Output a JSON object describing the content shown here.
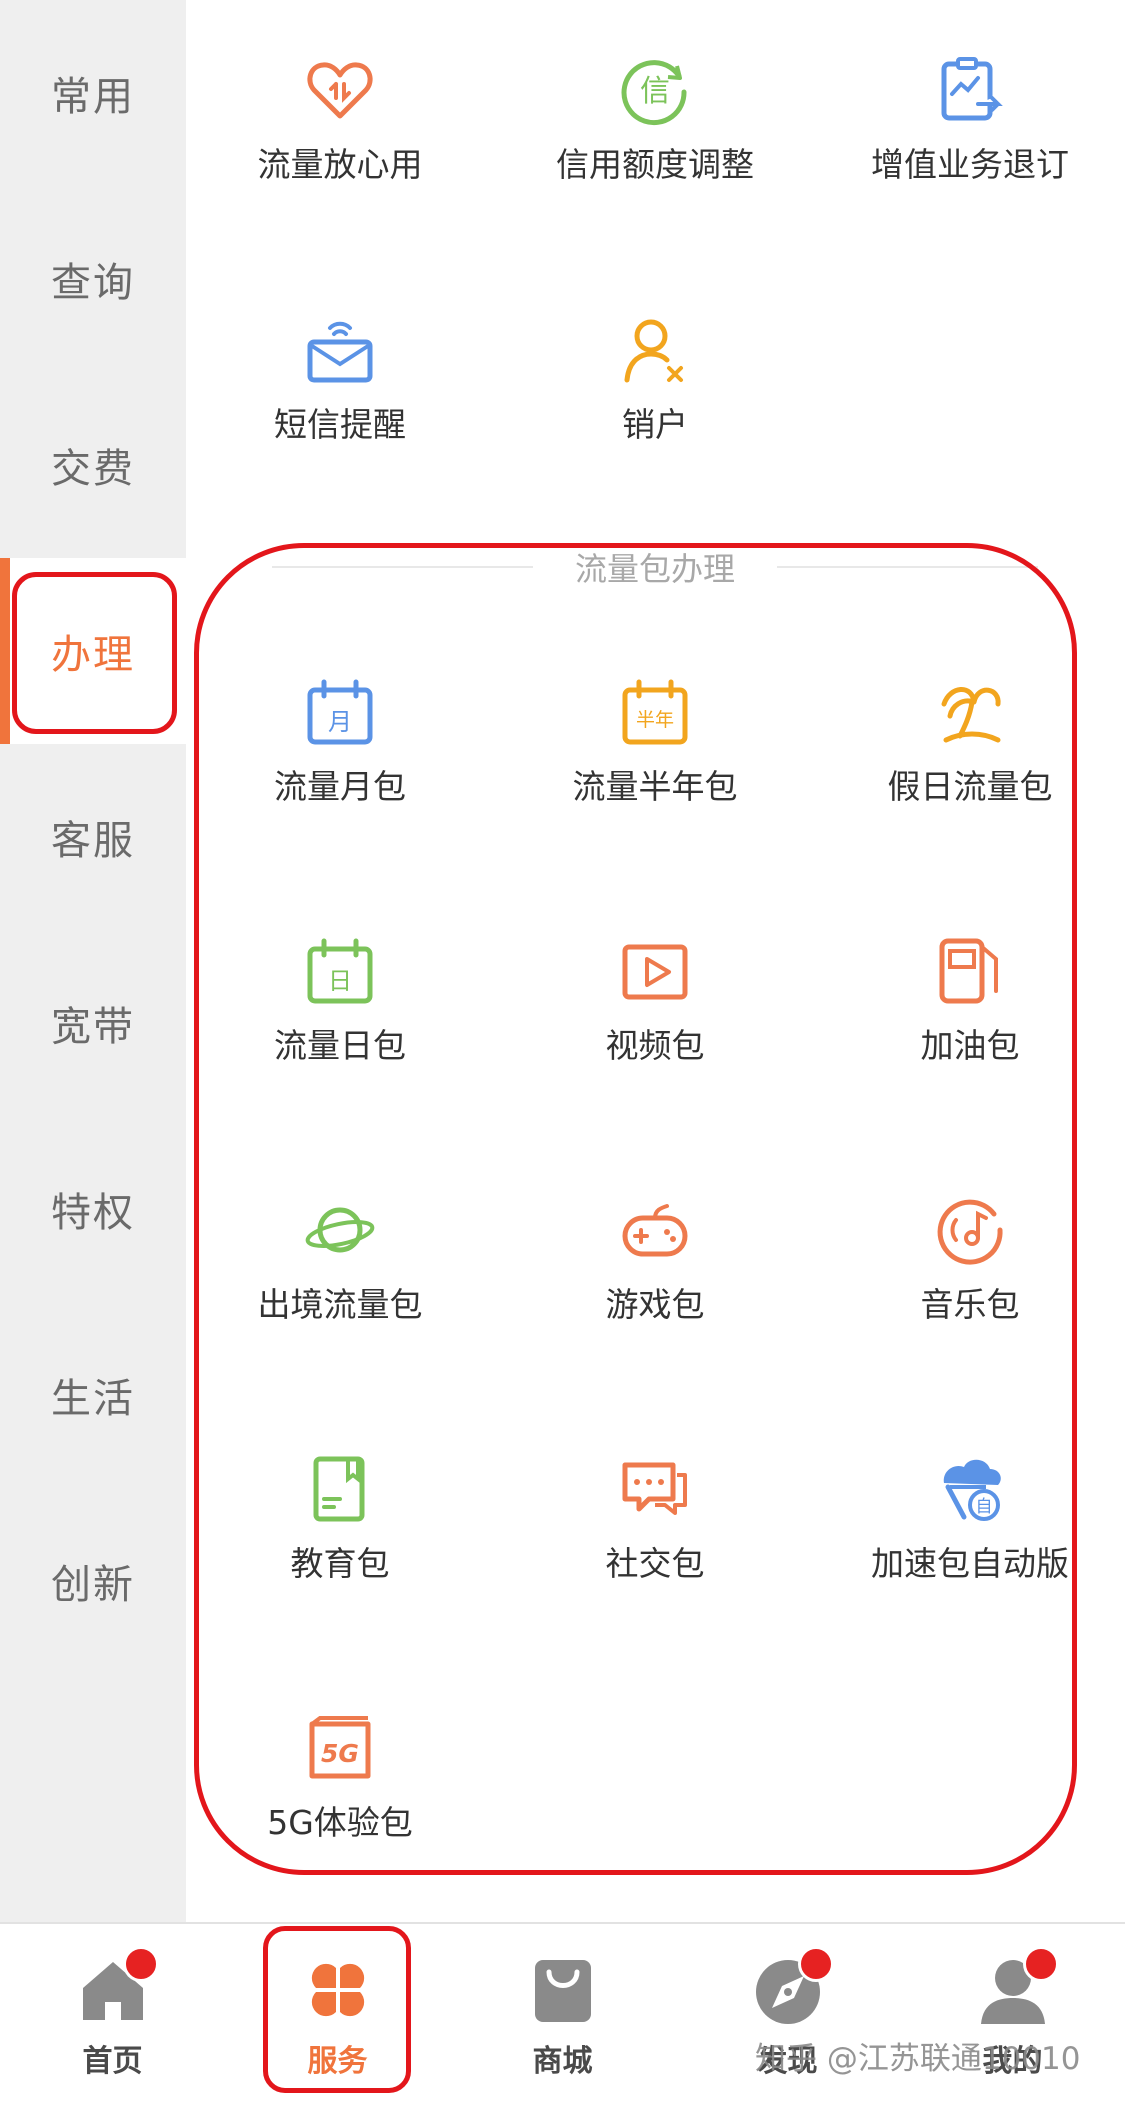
{
  "sidebar": {
    "items": [
      {
        "label": "常用"
      },
      {
        "label": "查询"
      },
      {
        "label": "交费"
      },
      {
        "label": "办理",
        "active": true
      },
      {
        "label": "客服"
      },
      {
        "label": "宽带"
      },
      {
        "label": "特权"
      },
      {
        "label": "生活"
      },
      {
        "label": "创新"
      }
    ]
  },
  "common_services": [
    {
      "label": "流量放心用",
      "icon": "heart-data-icon"
    },
    {
      "label": "信用额度调整",
      "icon": "credit-icon"
    },
    {
      "label": "增值业务退订",
      "icon": "unsubscribe-icon"
    },
    {
      "label": "短信提醒",
      "icon": "sms-icon"
    },
    {
      "label": "销户",
      "icon": "close-account-icon"
    }
  ],
  "packages": {
    "title": "流量包办理",
    "items": [
      {
        "label": "流量月包",
        "icon": "calendar-month-icon",
        "glyph": "月"
      },
      {
        "label": "流量半年包",
        "icon": "calendar-halfyear-icon",
        "glyph": "半年"
      },
      {
        "label": "假日流量包",
        "icon": "palm-tree-icon"
      },
      {
        "label": "流量日包",
        "icon": "calendar-day-icon",
        "glyph": "日"
      },
      {
        "label": "视频包",
        "icon": "video-play-icon"
      },
      {
        "label": "加油包",
        "icon": "fuel-pump-icon"
      },
      {
        "label": "出境流量包",
        "icon": "planet-icon"
      },
      {
        "label": "游戏包",
        "icon": "gamepad-icon"
      },
      {
        "label": "音乐包",
        "icon": "music-disc-icon"
      },
      {
        "label": "教育包",
        "icon": "book-icon"
      },
      {
        "label": "社交包",
        "icon": "chat-bubble-icon"
      },
      {
        "label": "加速包自动版",
        "icon": "speed-cloud-icon",
        "glyph": "自"
      },
      {
        "label": "5G体验包",
        "icon": "5g-card-icon",
        "glyph": "5G"
      }
    ]
  },
  "bottom_nav": [
    {
      "label": "首页",
      "icon": "home-icon",
      "badge": true
    },
    {
      "label": "服务",
      "icon": "services-grid-icon",
      "active": true
    },
    {
      "label": "商城",
      "icon": "shopping-bag-icon"
    },
    {
      "label": "发现",
      "icon": "compass-icon",
      "badge": true
    },
    {
      "label": "我的",
      "icon": "profile-icon",
      "badge": true
    }
  ],
  "watermark": "知乎 @江苏联通10010",
  "colors": {
    "accent": "#f0743c",
    "highlight_red": "#e3161b",
    "blue": "#5b93e6",
    "green": "#7cc35a",
    "yellow": "#f2a51e",
    "orange": "#ee7a4d"
  }
}
